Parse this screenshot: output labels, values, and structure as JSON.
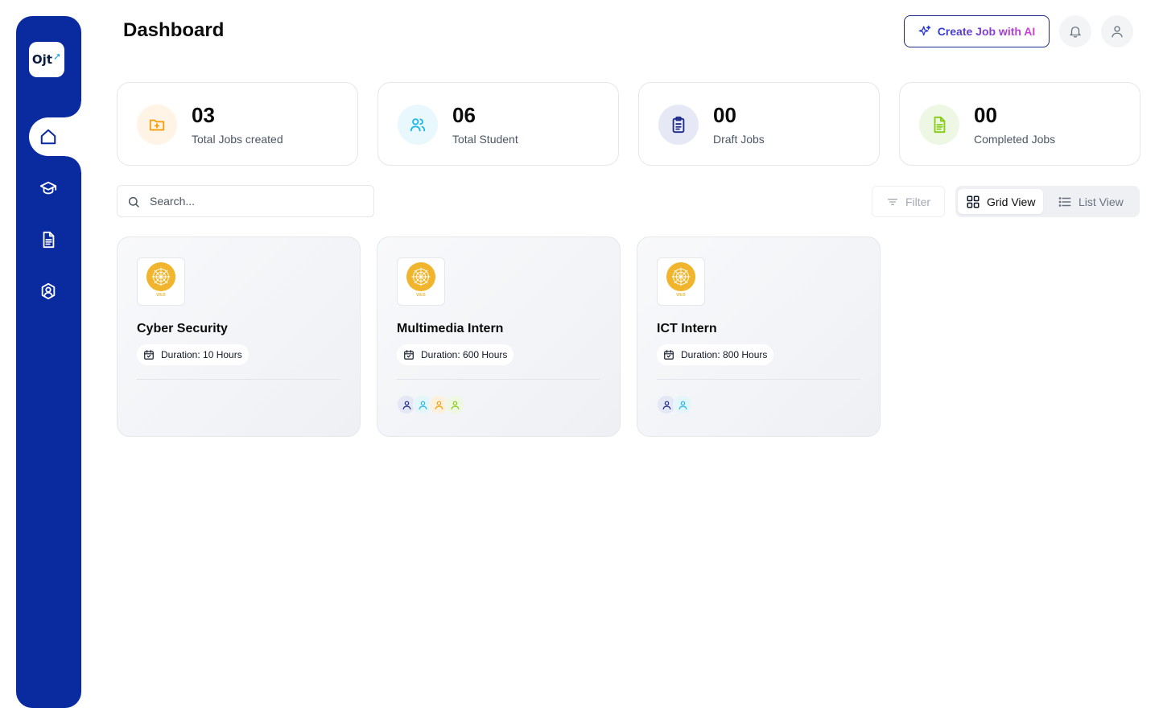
{
  "sidebar": {
    "logo_text": "Ojt",
    "items": [
      {
        "name": "home",
        "icon": "home-icon",
        "active": true
      },
      {
        "name": "students",
        "icon": "graduation-cap-icon",
        "active": false
      },
      {
        "name": "documents",
        "icon": "document-icon",
        "active": false
      },
      {
        "name": "profile",
        "icon": "user-shield-icon",
        "active": false
      }
    ]
  },
  "header": {
    "title": "Dashboard",
    "ai_button_label": "Create Job with AI"
  },
  "stats": [
    {
      "value": "03",
      "label": "Total Jobs created",
      "icon": "folder-plus-icon",
      "color": "#f59e0b",
      "bg": "#fff4e6"
    },
    {
      "value": "06",
      "label": "Total Student",
      "icon": "users-icon",
      "color": "#22b7e8",
      "bg": "#e8f8fd"
    },
    {
      "value": "00",
      "label": "Draft Jobs",
      "icon": "clipboard-icon",
      "color": "#1e2a8a",
      "bg": "#e6e9f5"
    },
    {
      "value": "00",
      "label": "Completed Jobs",
      "icon": "file-text-icon",
      "color": "#84cc16",
      "bg": "#eef7e4"
    }
  ],
  "toolbar": {
    "search_placeholder": "Search...",
    "filter_label": "Filter",
    "grid_view_label": "Grid View",
    "list_view_label": "List View",
    "active_view": "grid"
  },
  "jobs": [
    {
      "title": "Cyber Security",
      "duration": "Duration: 10 Hours",
      "logo_text": "WEB",
      "applicants": []
    },
    {
      "title": "Multimedia Intern",
      "duration": "Duration: 600 Hours",
      "logo_text": "WEB",
      "applicants": [
        "#1e2a8a",
        "#22b7e8",
        "#f59e0b",
        "#84cc16"
      ]
    },
    {
      "title": "ICT Intern",
      "duration": "Duration: 800 Hours",
      "logo_text": "WEB",
      "applicants": [
        "#1e2a8a",
        "#22b7e8"
      ]
    }
  ],
  "colors": {
    "brand": "#0a2aa0",
    "accent_gradient_start": "#2d3bd6",
    "accent_gradient_end": "#d63fd6"
  }
}
